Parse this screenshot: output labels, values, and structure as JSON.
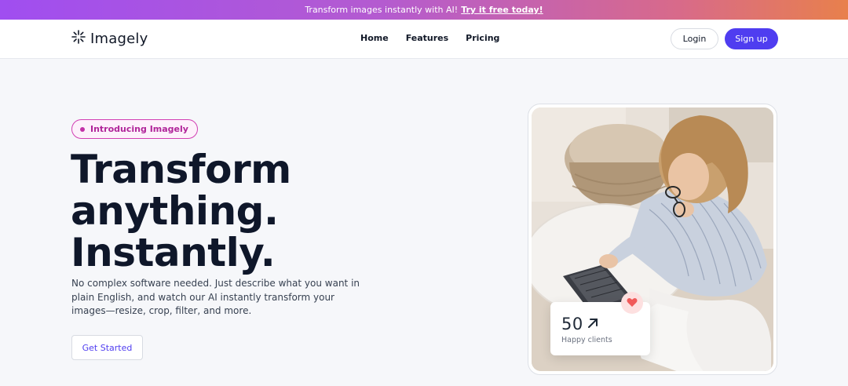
{
  "announcement": {
    "text": "Transform images instantly with AI!",
    "link_label": "Try it free today!"
  },
  "nav": {
    "brand": "Imagely",
    "brand_icon": "sparkle-burst-icon",
    "links": [
      "Home",
      "Features",
      "Pricing"
    ],
    "login_label": "Login",
    "signup_label": "Sign up"
  },
  "hero": {
    "badge": "Introducing Imagely",
    "headline": [
      "Transform",
      "anything.",
      "Instantly."
    ],
    "description": "No complex software needed. Just describe what you want in plain English, and watch our AI instantly transform your images—resize, crop, filter, and more.",
    "cta_label": "Get Started"
  },
  "stat": {
    "value": "50",
    "value_icon": "arrow-up-right-icon",
    "label": "Happy clients",
    "badge_icon": "heart-icon"
  },
  "colors": {
    "accent": "#4f3df0",
    "badge": "#c231a8",
    "heart": "#f05a5a",
    "announce_start": "#a04ef0",
    "announce_end": "#e8804c"
  }
}
